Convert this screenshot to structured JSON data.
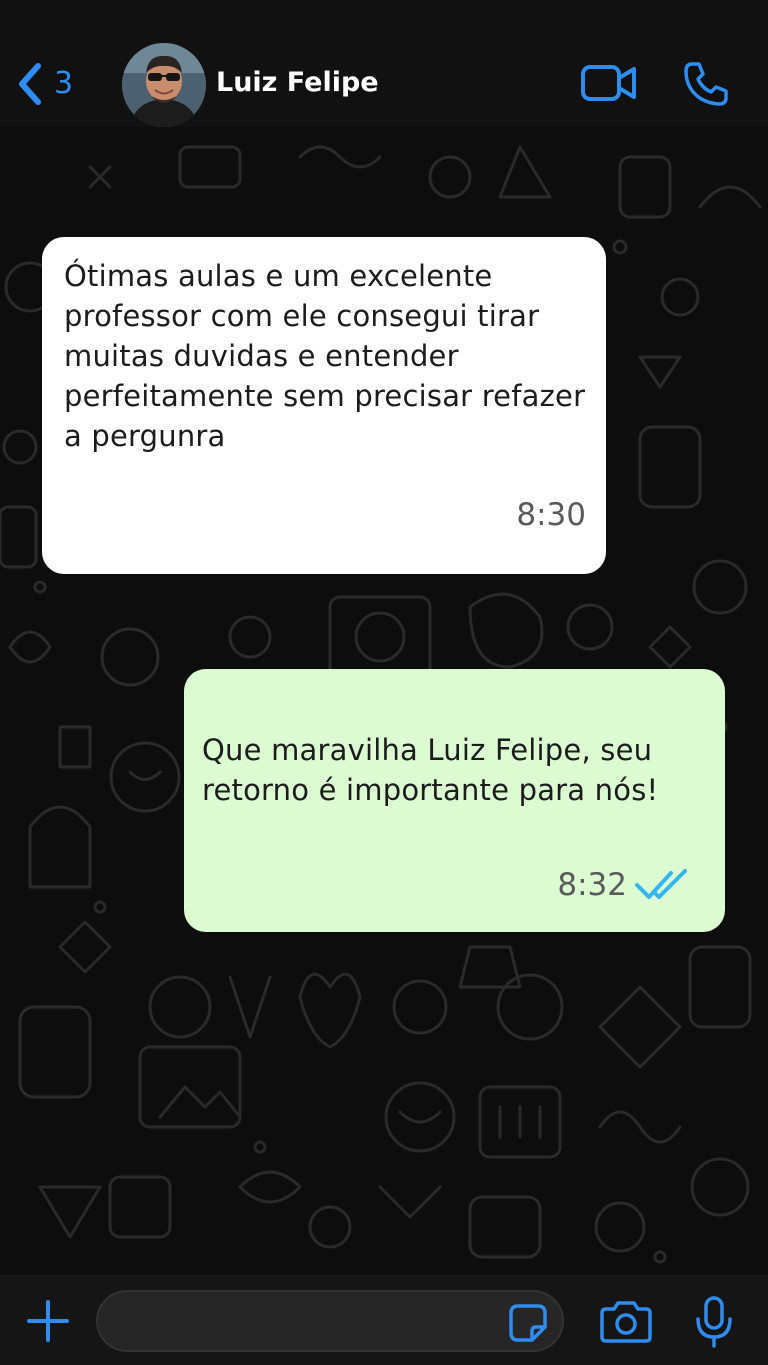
{
  "header": {
    "back_count": "3",
    "contact_name": "Luiz Felipe",
    "icons": [
      "chevron-left-icon",
      "video-call-icon",
      "phone-icon"
    ]
  },
  "messages": [
    {
      "direction": "incoming",
      "text": "Ótimas aulas e um excelente professor com ele consegui tirar muitas duvidas e entender perfeitamente sem precisar refazer a pergunra",
      "time": "8:30"
    },
    {
      "direction": "outgoing",
      "text": "Que maravilha Luiz Felipe, seu retorno é importante para nós!",
      "time": "8:32",
      "status": "read"
    }
  ],
  "footer": {
    "input_value": "",
    "icons": [
      "plus-icon",
      "sticker-icon",
      "camera-icon",
      "microphone-icon"
    ]
  },
  "colors": {
    "accent": "#2f8cf0",
    "header_bg": "#111111",
    "incoming_bubble": "#ffffff",
    "outgoing_bubble": "#dcfbd2",
    "read_ticks": "#34b7f1"
  }
}
